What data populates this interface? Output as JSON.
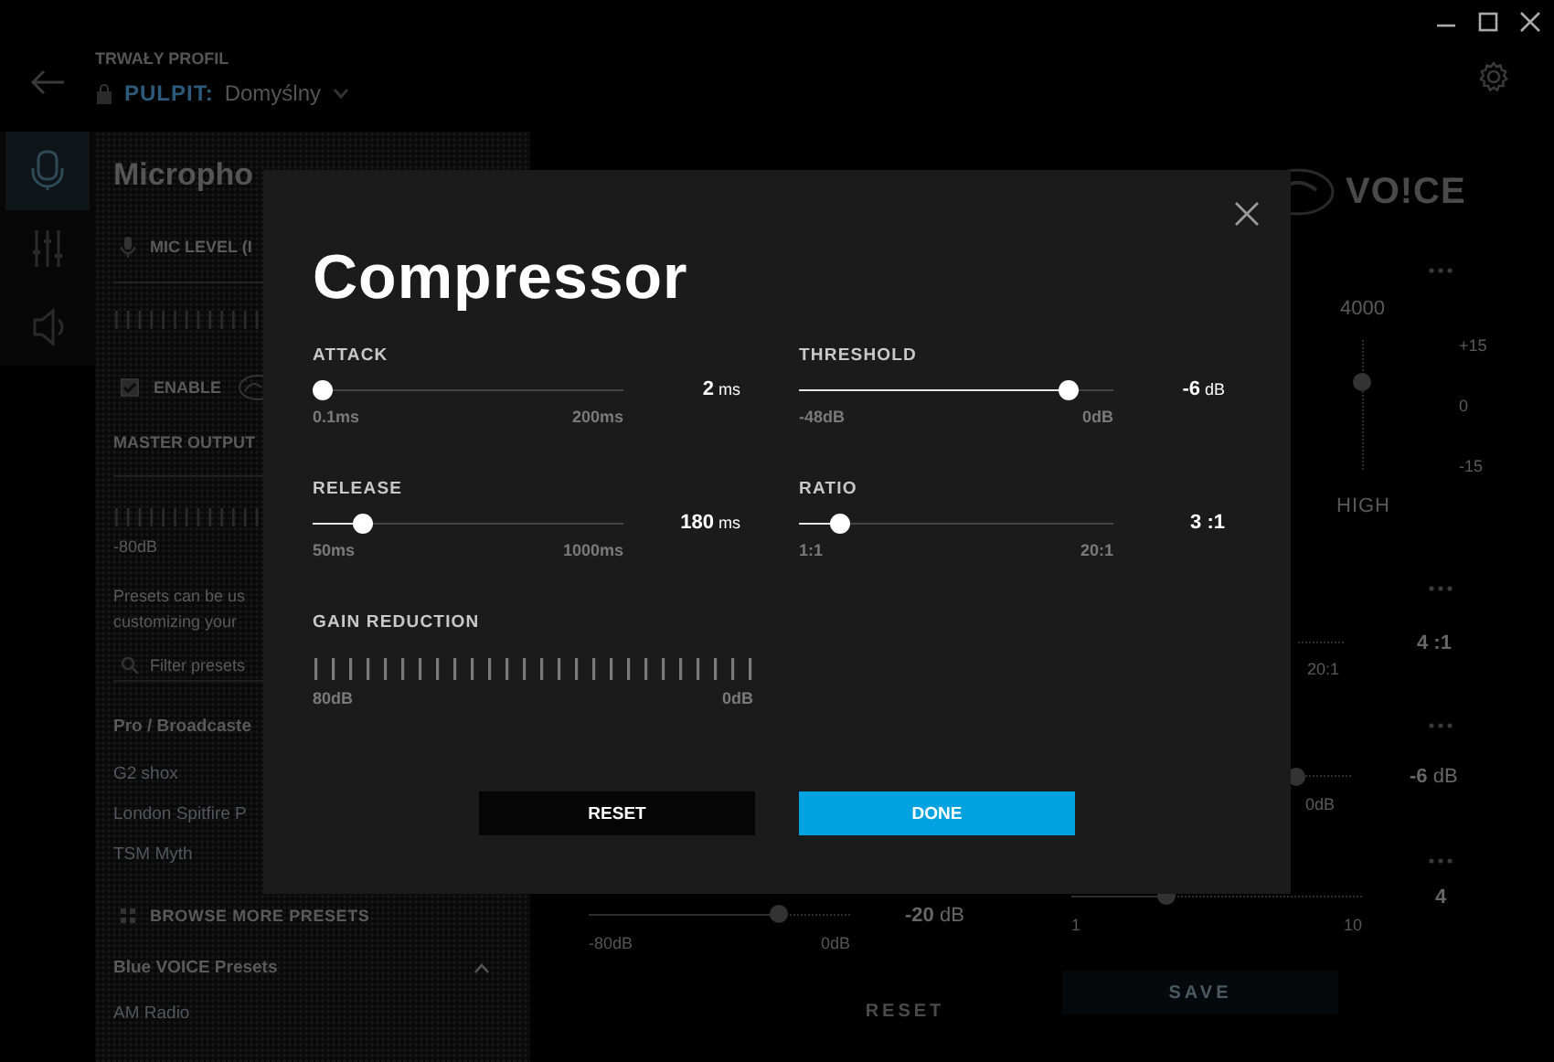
{
  "profile": {
    "label": "TRWAŁY PROFIL",
    "mode": "PULPIT:",
    "name": "Domyślny"
  },
  "nav": [
    {
      "kind": "microphone",
      "selected": true
    },
    {
      "kind": "mixer",
      "selected": false
    },
    {
      "kind": "speaker",
      "selected": false
    }
  ],
  "panel": {
    "title": "Micropho",
    "mic_level": "MIC LEVEL (I",
    "enable": {
      "label": "ENABLE",
      "checked": true
    },
    "master_output": "MASTER OUTPUT",
    "output_min": "-80dB",
    "presets_note": [
      "Presets can be us",
      "customizing your"
    ],
    "filter": {
      "placeholder": "Filter presets"
    },
    "groups": [
      {
        "title": "Pro / Broadcaste",
        "items": [
          "G2 shox",
          "London Spitfire P",
          "TSM Myth"
        ]
      }
    ],
    "browse": "BROWSE MORE PRESETS",
    "blue_group": {
      "title": "Blue VOICE Presets",
      "expanded": true,
      "items": [
        "AM Radio"
      ]
    }
  },
  "middle": {
    "slider": {
      "min": "-80dB",
      "max": "0dB",
      "value": "**-20** dB",
      "level": 0.73
    },
    "reset": "RESET"
  },
  "right": {
    "logo": "VO!CE",
    "eq": {
      "frequency": "4000",
      "band": "HIGH",
      "scale": [
        "+15",
        "0",
        "-15"
      ],
      "level": 0.68
    },
    "ratio": {
      "value": "4 :1",
      "max": "20:1"
    },
    "threshold": {
      "value": "**-6** dB",
      "max": "0dB"
    },
    "gain": {
      "value": "4",
      "min": "1",
      "max": "10",
      "level": 0.33
    },
    "save": "SAVE"
  },
  "dialog": {
    "title": "Compressor",
    "sliders": [
      {
        "label": "ATTACK",
        "min": "0.1ms",
        "max": "200ms",
        "value": "**2** ms",
        "level": 0.035
      },
      {
        "label": "THRESHOLD",
        "min": "-48dB",
        "max": "0dB",
        "value": "**-6** dB",
        "level": 0.855
      },
      {
        "label": "RELEASE",
        "min": "50ms",
        "max": "1000ms",
        "value": "**180** ms",
        "level": 0.16
      },
      {
        "label": "RATIO",
        "min": "1:1",
        "max": "20:1",
        "value": "3 :1",
        "level": 0.128
      }
    ],
    "gain_reduction": {
      "label": "GAIN REDUCTION",
      "min": "80dB",
      "max": "0dB"
    },
    "buttons": [
      {
        "label": "RESET",
        "kind": "secondary"
      },
      {
        "label": "DONE",
        "kind": "primary"
      }
    ]
  }
}
